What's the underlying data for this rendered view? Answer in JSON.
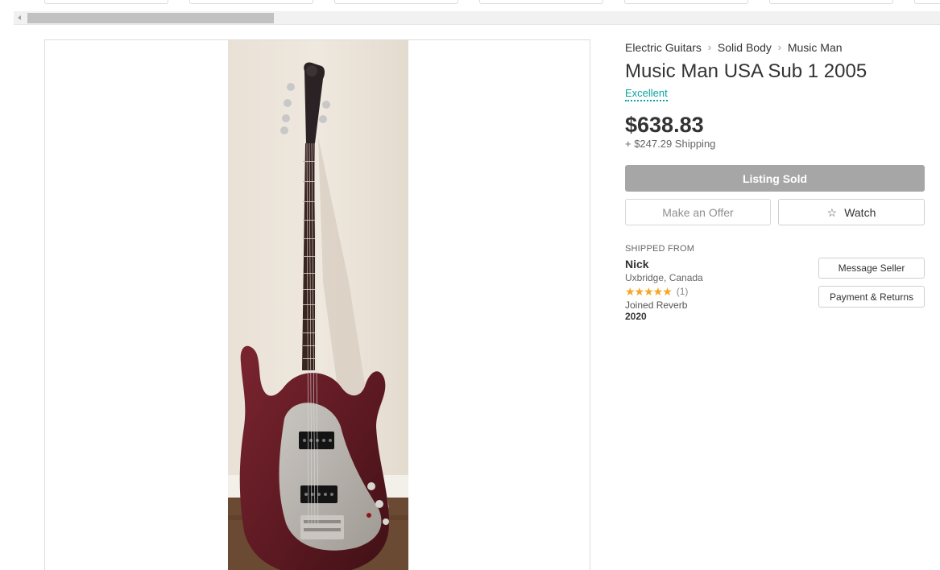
{
  "breadcrumb": {
    "items": [
      "Electric Guitars",
      "Solid Body",
      "Music Man"
    ]
  },
  "listing": {
    "title": "Music Man USA Sub 1 2005",
    "condition": "Excellent",
    "price": "$638.83",
    "shipping": "+ $247.29 Shipping"
  },
  "actions": {
    "sold_label": "Listing Sold",
    "offer_label": "Make an Offer",
    "watch_label": "Watch",
    "watch_icon": "star-outline-icon"
  },
  "seller": {
    "shipped_from_label": "SHIPPED FROM",
    "name": "Nick",
    "location": "Uxbridge, Canada",
    "rating_stars": 5,
    "rating_count": "(1)",
    "joined_label": "Joined Reverb",
    "joined_year": "2020",
    "message_label": "Message Seller",
    "payment_label": "Payment & Returns"
  },
  "colors": {
    "condition": "#0ba2a2",
    "sold_button": "#a6a6a6",
    "star": "#f5a623",
    "guitar_body": "#5a1820"
  }
}
